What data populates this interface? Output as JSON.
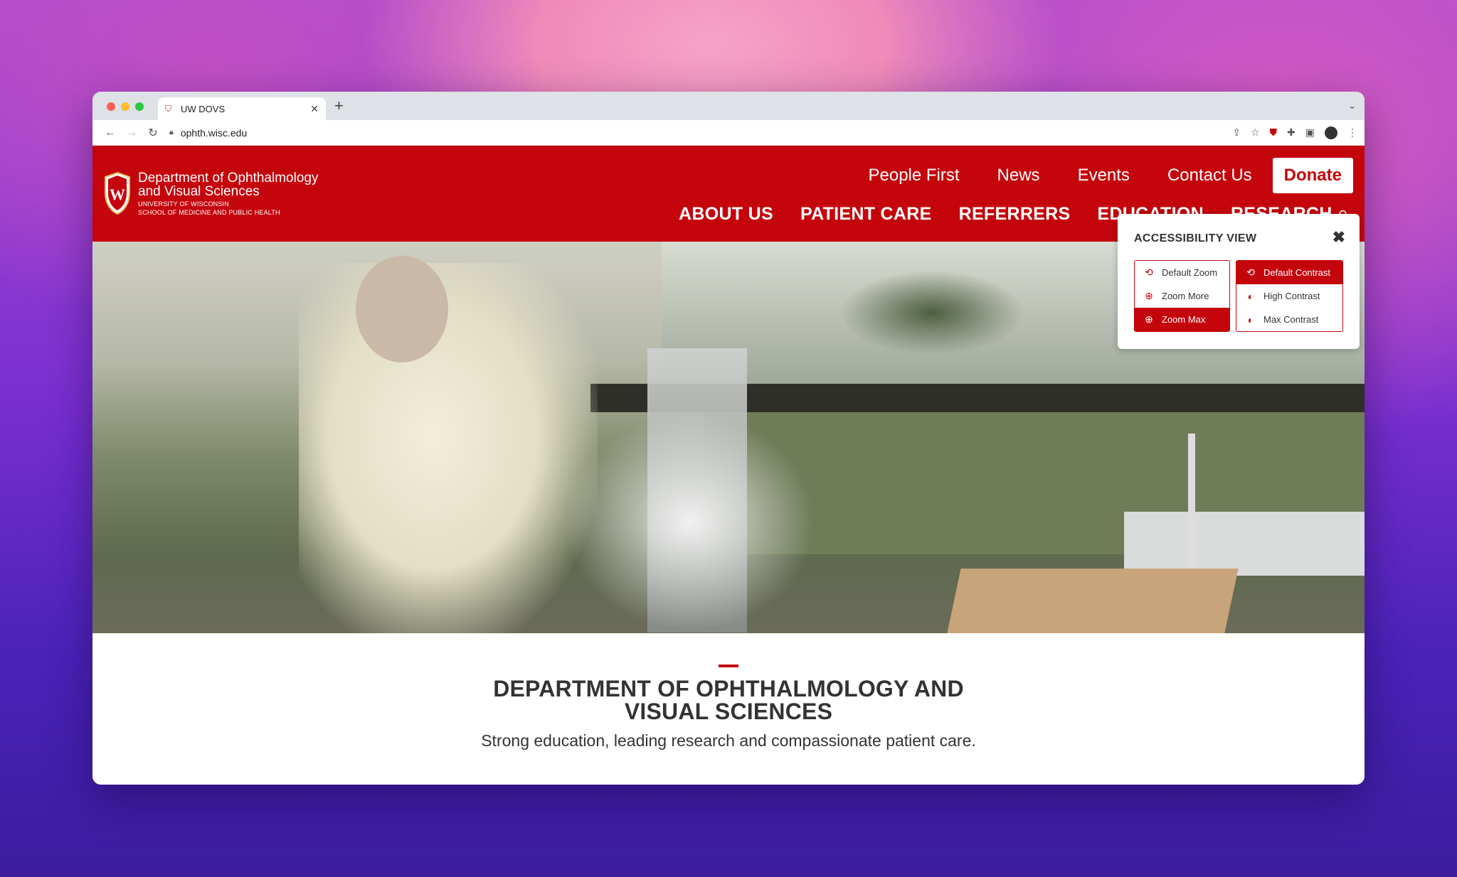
{
  "browser": {
    "tab_title": "UW DOVS",
    "url": "ophth.wisc.edu"
  },
  "site": {
    "brand": {
      "dept_line1": "Department of Ophthalmology",
      "dept_line2": "and Visual Sciences",
      "uni": "UNIVERSITY OF WISCONSIN",
      "school": "SCHOOL OF MEDICINE AND PUBLIC HEALTH"
    },
    "utility_nav": [
      "People First",
      "News",
      "Events",
      "Contact Us"
    ],
    "donate_label": "Donate",
    "main_nav": [
      "ABOUT US",
      "PATIENT CARE",
      "REFERRERS",
      "EDUCATION",
      "RESEARCH"
    ]
  },
  "intro": {
    "heading": "DEPARTMENT OF OPHTHALMOLOGY AND VISUAL SCIENCES",
    "tagline": "Strong education, leading research and compassionate patient care."
  },
  "accessibility": {
    "title": "ACCESSIBILITY VIEW",
    "zoom_options": [
      {
        "label": "Default Zoom",
        "icon": "refresh-icon",
        "active": false
      },
      {
        "label": "Zoom More",
        "icon": "zoom-in-icon",
        "active": false
      },
      {
        "label": "Zoom Max",
        "icon": "zoom-in-icon",
        "active": true
      }
    ],
    "contrast_options": [
      {
        "label": "Default Contrast",
        "icon": "refresh-icon",
        "active": true
      },
      {
        "label": "High Contrast",
        "icon": "contrast-icon",
        "active": false
      },
      {
        "label": "Max Contrast",
        "icon": "contrast-icon",
        "active": false
      }
    ]
  },
  "colors": {
    "brand_red": "#c5050c"
  }
}
